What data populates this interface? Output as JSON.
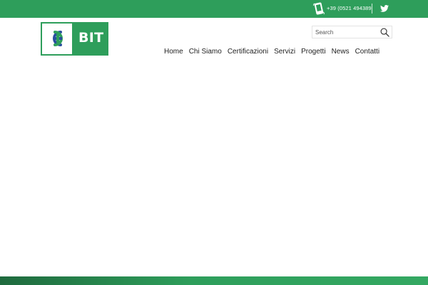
{
  "topbar": {
    "phone_icon": "mobile-phone-icon",
    "phone": "+39 (0521 494389",
    "social_icon": "twitter-icon",
    "color": "#2e9e5b"
  },
  "logo": {
    "text": "BIT",
    "mark_icon": "bit-logo-mark",
    "colors": {
      "green": "#2e9e5b",
      "blue": "#2a4f9e"
    }
  },
  "search": {
    "placeholder": "Search",
    "icon": "search-icon"
  },
  "nav": {
    "items": [
      "Home",
      "Chi Siamo",
      "Certificazioni",
      "Servizi",
      "Progetti",
      "News",
      "Contatti"
    ]
  },
  "footer": {
    "gradient": [
      "#1f6a3e",
      "#34a862"
    ]
  }
}
